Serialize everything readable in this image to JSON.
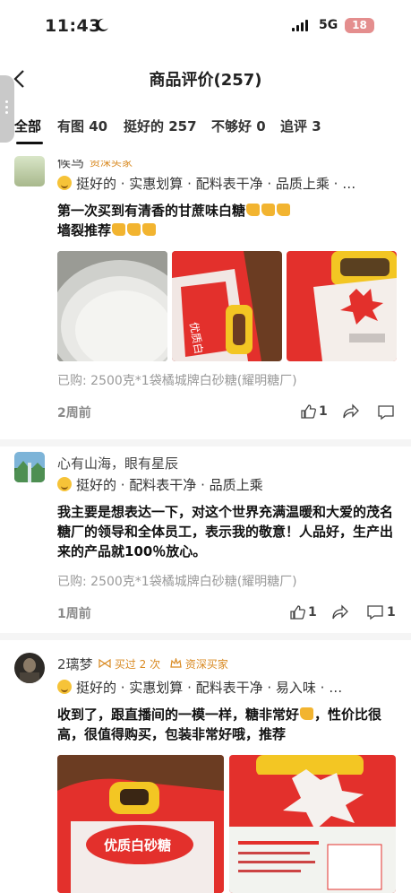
{
  "status": {
    "time": "11:43",
    "network": "5G",
    "battery": "18"
  },
  "nav": {
    "title": "商品评价(257)"
  },
  "tabs": [
    {
      "label": "全部"
    },
    {
      "label": "有图 40"
    },
    {
      "label": "挺好的 257"
    },
    {
      "label": "不够好 0"
    },
    {
      "label": "追评 3"
    }
  ],
  "reviews": [
    {
      "username": "候鸟",
      "badge": "资深买家",
      "tags": "挺好的 · 实惠划算 · 配料表干净 · 品质上乘 · …",
      "content_line1": "第一次买到有清香的甘蔗味白糖",
      "content_line2": "墙裂推荐",
      "purchased": "已购: 2500克*1袋橘城牌白砂糖(耀明糖厂)",
      "time": "2周前",
      "likes": "1",
      "comments": ""
    },
    {
      "username": "心有山海，眼有星辰",
      "badge": "",
      "tags": "挺好的 · 配料表干净 · 品质上乘",
      "content": "我主要是想表达一下，对这个世界充满温暖和大爱的茂名糖厂的领导和全体员工，表示我的敬意！人品好，生产出来的产品就100％放心。",
      "purchased": "已购: 2500克*1袋橘城牌白砂糖(耀明糖厂)",
      "time": "1周前",
      "likes": "1",
      "comments": "1"
    },
    {
      "username": "2璃梦",
      "bought_times": "买过 2 次",
      "badge": "资深买家",
      "tags": "挺好的 · 实惠划算 · 配料表干净 · 易入味 · …",
      "content_line1": "收到了，跟直播间的一模一样，糖非常好",
      "content_line1b": "，性价比很",
      "content_line2": "高，很值得购买，包装非常好哦，推荐"
    }
  ],
  "colors": {
    "accent": "#d98a22",
    "gray_text": "#9a9a9a",
    "bag_red": "#e3302c",
    "handle_yellow": "#f3c623"
  }
}
